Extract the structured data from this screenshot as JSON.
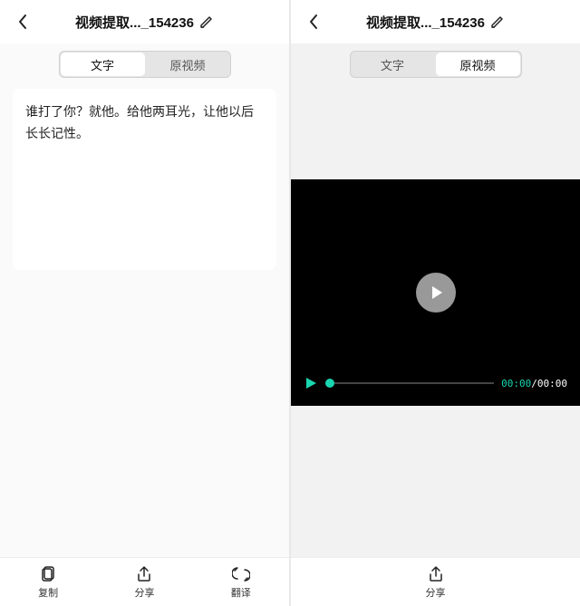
{
  "left": {
    "header": {
      "title": "视频提取..._154236"
    },
    "tabs": {
      "text": "文字",
      "video": "原视频",
      "active": "text"
    },
    "content": {
      "text": "谁打了你？就他。给他两耳光，让他以后长长记性。"
    },
    "bottombar": {
      "copy": "复制",
      "share": "分享",
      "translate": "翻译"
    }
  },
  "right": {
    "header": {
      "title": "视频提取..._154236"
    },
    "tabs": {
      "text": "文字",
      "video": "原视频",
      "active": "video"
    },
    "player": {
      "current": "00:00",
      "duration": "00:00"
    },
    "bottombar": {
      "share": "分享"
    }
  },
  "colors": {
    "accent": "#18d6b0"
  }
}
